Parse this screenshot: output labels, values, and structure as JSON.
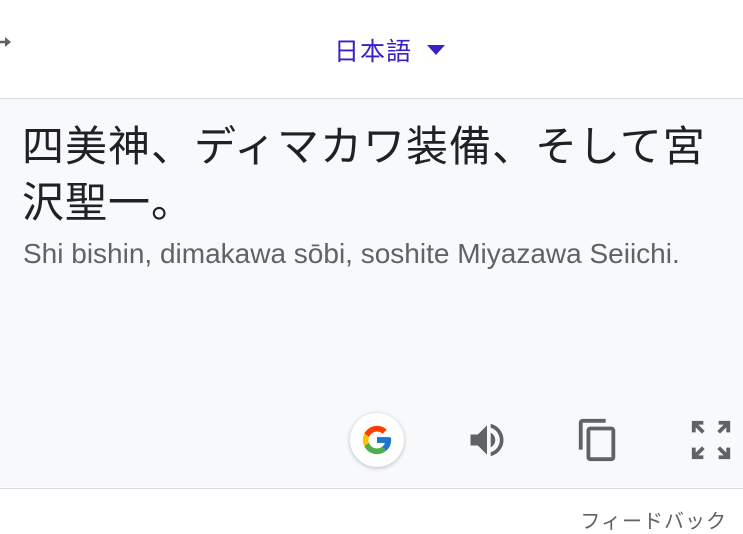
{
  "header": {
    "target_language": "日本語",
    "icons": {
      "swap": "arrow-right-icon",
      "dropdown": "caret-down-icon"
    },
    "accent_color": "#3b20c6"
  },
  "result": {
    "translated_text": "四美神、ディマカワ装備、そして宮沢聖一。",
    "romanization": "Shi bishin, dimakawa sōbi, soshite Miyazawa Seiichi."
  },
  "toolbar": {
    "icons": [
      "google-icon",
      "speaker-icon",
      "copy-icon",
      "fullscreen-icon"
    ]
  },
  "footer": {
    "feedback_label": "フィードバック"
  }
}
